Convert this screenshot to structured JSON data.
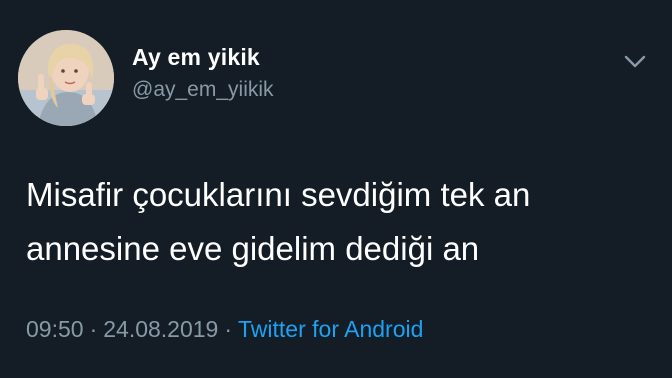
{
  "author": {
    "display_name": "Ay em yikik",
    "handle": "@ay_em_yiikik"
  },
  "tweet": {
    "text_lines": [
      "Misafir çocuklarını sevdiğim tek an",
      "annesine eve gidelim dediği an"
    ],
    "time": "09:50",
    "separator": "·",
    "date": "24.08.2019",
    "source": "Twitter for Android"
  },
  "icons": {
    "menu": "chevron-down-icon",
    "avatar": "profile-photo"
  },
  "colors": {
    "background": "#141d26",
    "muted_text": "#8899a6",
    "link": "#1da1f2",
    "primary_text": "#ffffff"
  }
}
